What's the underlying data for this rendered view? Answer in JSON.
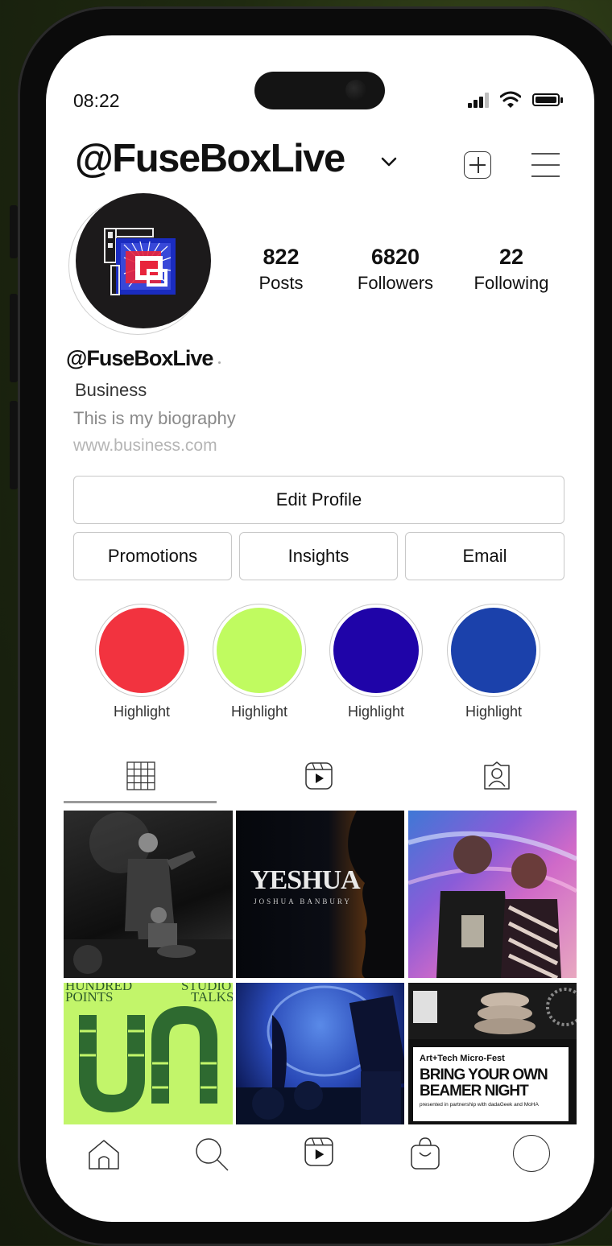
{
  "status_bar": {
    "time": "08:22"
  },
  "header": {
    "username": "@FuseBoxLive"
  },
  "profile": {
    "stats": [
      {
        "value": "822",
        "label": "Posts"
      },
      {
        "value": "6820",
        "label": "Followers"
      },
      {
        "value": "22",
        "label": "Following"
      }
    ],
    "name": "@FuseBoxLive",
    "category": "Business",
    "bio": "This is my biography",
    "website": "www.business.com"
  },
  "buttons": {
    "edit_profile": "Edit Profile",
    "promotions": "Promotions",
    "insights": "Insights",
    "email": "Email"
  },
  "highlights": [
    {
      "label": "Highlight",
      "color": "#f2333f"
    },
    {
      "label": "Highlight",
      "color": "#c0fb60"
    },
    {
      "label": "Highlight",
      "color": "#1f04a8"
    },
    {
      "label": "Highlight",
      "color": "#1b41ab"
    }
  ],
  "tabs": [
    {
      "icon": "grid-icon"
    },
    {
      "icon": "reels-icon"
    },
    {
      "icon": "tagged-icon"
    }
  ],
  "posts": {
    "yeshua_title": "YESHUA",
    "yeshua_subtitle": "JOSHUA BANBURY",
    "hundred_left": "HUNDRED",
    "hundred_points": "POINTS",
    "studio": "STUDIO",
    "talks": "TALKS",
    "fest_line1": "Art+Tech Micro-Fest",
    "fest_line2": "BRING YOUR OWN",
    "fest_line3": "BEAMER NIGHT",
    "fest_line4": "presented in partnership with dadaGeek and MoHA"
  },
  "bottom_nav": [
    {
      "icon": "home-icon"
    },
    {
      "icon": "search-icon"
    },
    {
      "icon": "reels-icon"
    },
    {
      "icon": "shop-icon"
    },
    {
      "icon": "profile-icon"
    }
  ]
}
